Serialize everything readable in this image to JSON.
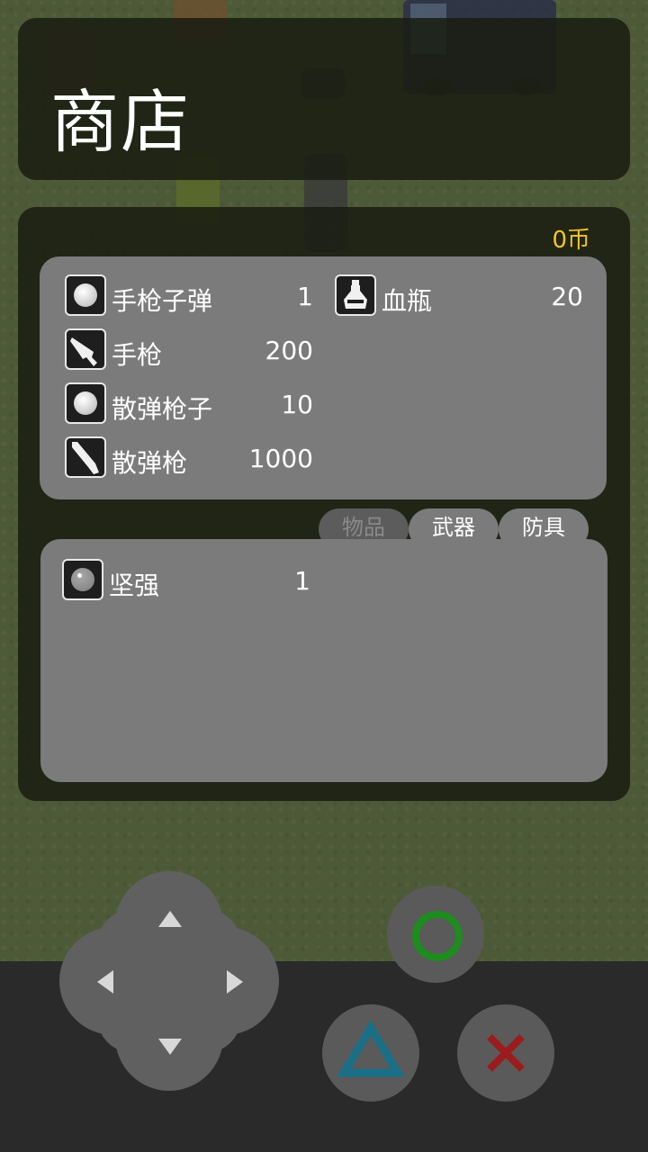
{
  "title": "商店",
  "coins": "0币",
  "shop_items": [
    {
      "name": "手枪子弹",
      "price": "1",
      "icon": "ammo-ball-icon"
    },
    {
      "name": "手枪",
      "price": "200",
      "icon": "pistol-icon"
    },
    {
      "name": "散弹枪子",
      "price": "10",
      "icon": "ammo-ball-icon"
    },
    {
      "name": "散弹枪",
      "price": "1000",
      "icon": "shotgun-icon"
    },
    {
      "name": "血瓶",
      "price": "20",
      "icon": "potion-bottle-icon"
    }
  ],
  "tabs": [
    {
      "label": "物品",
      "active": true
    },
    {
      "label": "武器",
      "active": false
    },
    {
      "label": "防具",
      "active": false
    }
  ],
  "inventory": [
    {
      "name": "坚强",
      "count": "1",
      "icon": "pearl-icon"
    }
  ],
  "controls": {
    "dpad": "dpad",
    "circle_color": "#1e8c1e",
    "triangle_color": "#1a6f86",
    "cross_color": "#9a1c1c"
  }
}
